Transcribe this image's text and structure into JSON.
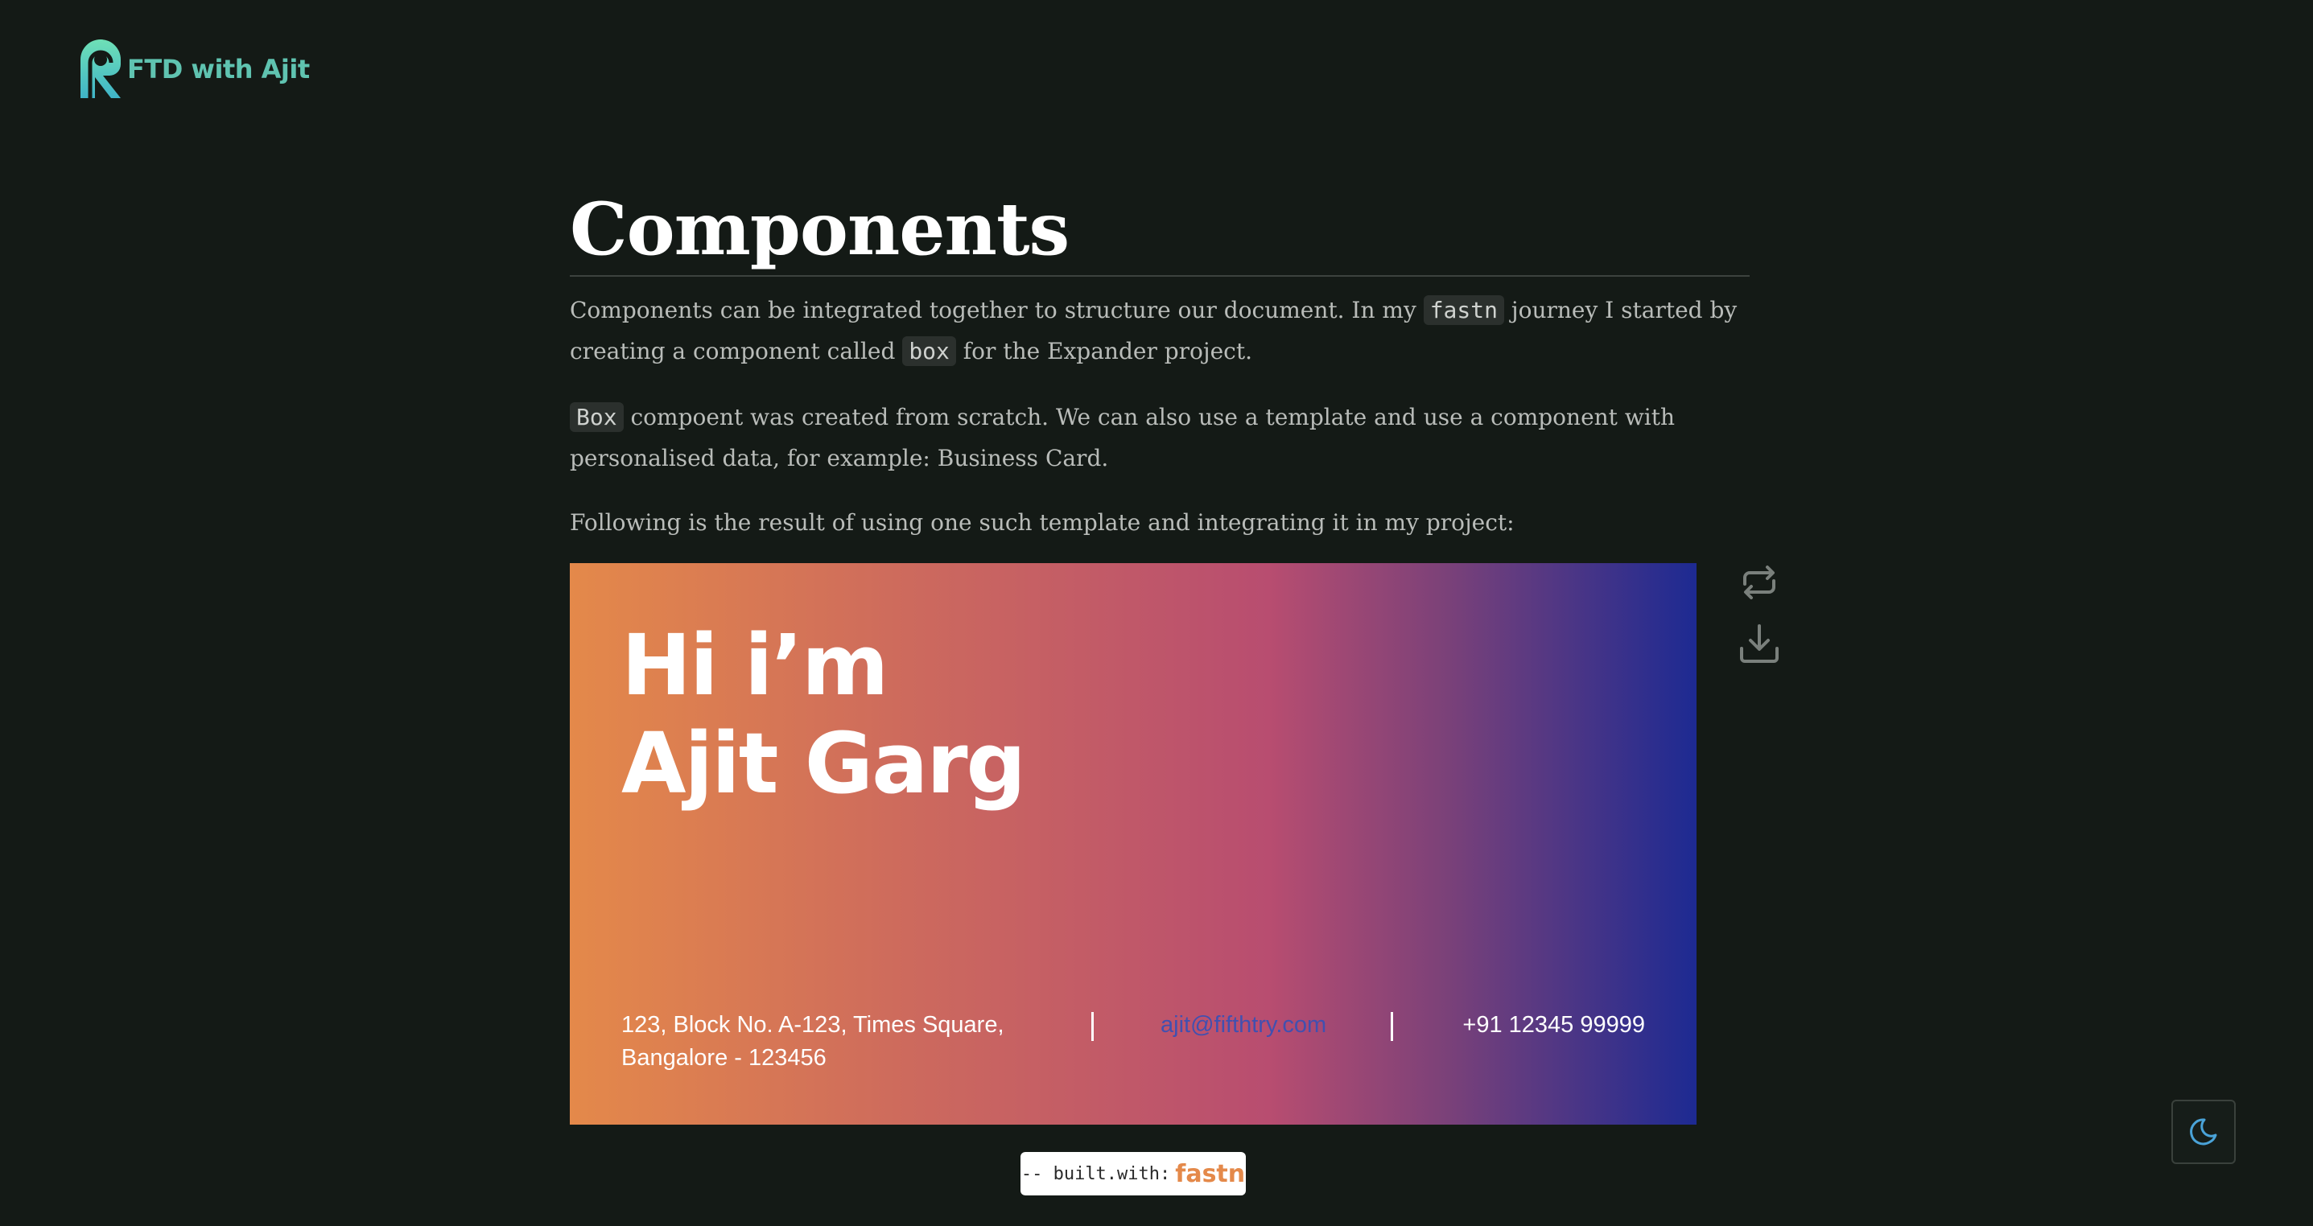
{
  "header": {
    "logo_text": "FTD with Ajit"
  },
  "page": {
    "title": "Components",
    "paragraph1": {
      "text_a": "Components can be integrated together to structure our document. In my ",
      "code_a": "fastn",
      "text_b": " journey I started by creating a component called ",
      "code_b": "box",
      "text_c": " for the Expander project."
    },
    "paragraph2": {
      "code": "Box",
      "text": " compoent was created from scratch. We can also use a template and use a component with personalised data, for example: Business Card."
    },
    "paragraph3": "Following is the result of using one such template and integrating it in my project:"
  },
  "card": {
    "greeting": "Hi i’m",
    "name": "Ajit Garg",
    "address_line1": "123, Block No. A-123, Times Square,",
    "address_line2": "Bangalore - 123456",
    "email": "ajit@fifthtry.com",
    "phone": "+91 12345 99999",
    "gradient_colors": [
      "#e4894a",
      "#b84d70",
      "#1d2a92"
    ]
  },
  "tools": {
    "flip_icon": "repeat-icon",
    "download_icon": "download-icon"
  },
  "footer": {
    "built_with": "-- built.with:",
    "brand": "fastn"
  },
  "theme_toggle": {
    "icon": "moon-icon"
  },
  "colors": {
    "background": "#141a16",
    "logo": "#5fc3b0",
    "brand_orange": "#e4894a",
    "email_link": "#4150b0"
  }
}
